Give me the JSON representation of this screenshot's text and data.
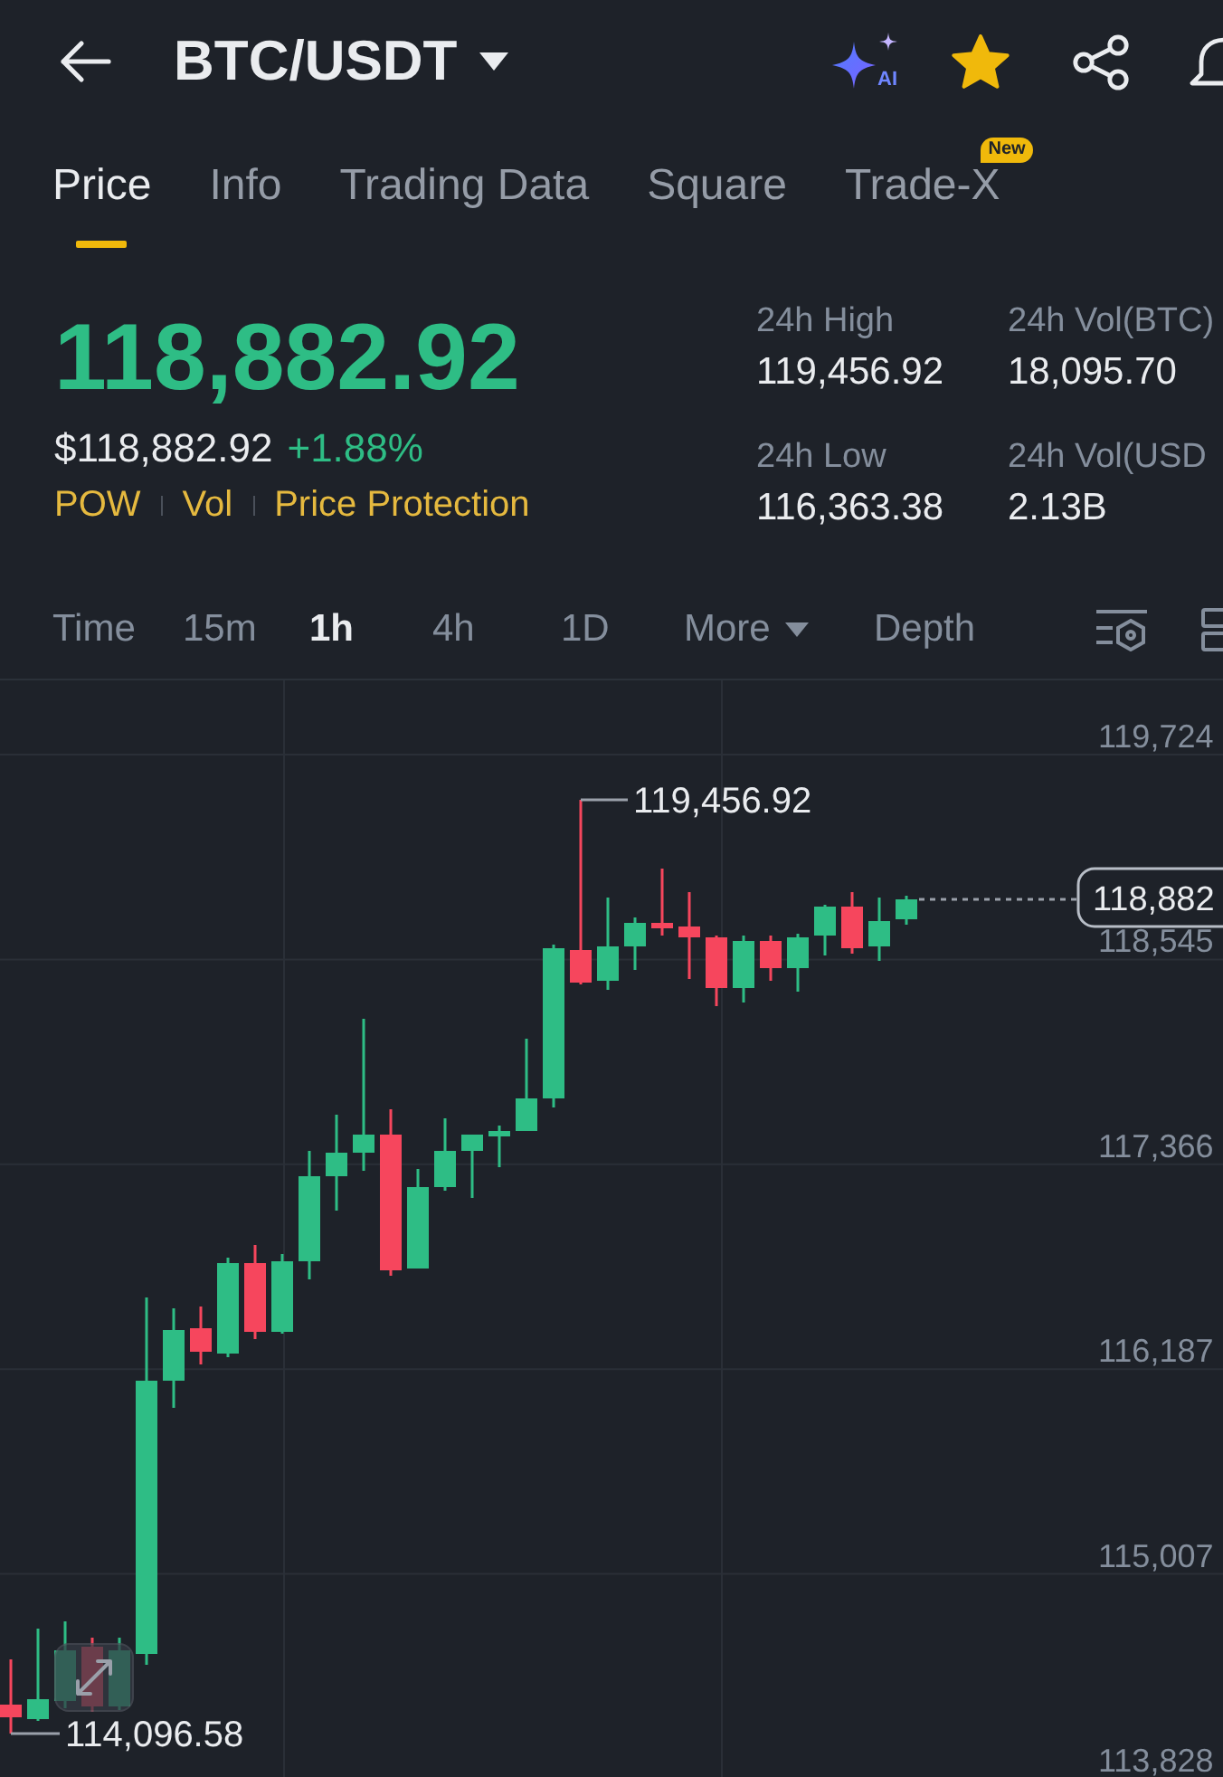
{
  "header": {
    "title": "BTC/USDT",
    "ai_label": "AI",
    "favorite": true
  },
  "tabs": [
    {
      "label": "Price",
      "selected": true
    },
    {
      "label": "Info",
      "selected": false
    },
    {
      "label": "Trading Data",
      "selected": false
    },
    {
      "label": "Square",
      "selected": false
    },
    {
      "label": "Trade-X",
      "selected": false,
      "badge": "New"
    }
  ],
  "ticker": {
    "last_price": "118,882.92",
    "usd_price": "$118,882.92",
    "change": "+1.88%",
    "tags": [
      "POW",
      "Vol",
      "Price Protection"
    ],
    "stats": [
      {
        "label": "24h High",
        "value": "119,456.92"
      },
      {
        "label": "24h Vol(BTC)",
        "value": "18,095.70"
      },
      {
        "label": "24h Low",
        "value": "116,363.38"
      },
      {
        "label": "24h Vol(USD",
        "value": "2.13B"
      }
    ]
  },
  "intervals": [
    {
      "label": "Time",
      "kind": "interval",
      "selected": false
    },
    {
      "label": "15m",
      "kind": "interval",
      "selected": false
    },
    {
      "label": "1h",
      "kind": "interval",
      "selected": true
    },
    {
      "label": "4h",
      "kind": "interval",
      "selected": false
    },
    {
      "label": "1D",
      "kind": "interval",
      "selected": false
    },
    {
      "label": "More",
      "kind": "dropdown",
      "selected": false
    },
    {
      "label": "Depth",
      "kind": "interval",
      "selected": false
    }
  ],
  "chart": {
    "price_axis": [
      "119,724",
      "118,545",
      "117,366",
      "116,187",
      "115,007",
      "113,828"
    ],
    "high_label": "119,456.92",
    "low_label": "114,096.58",
    "last_price_label": "118,882"
  }
}
